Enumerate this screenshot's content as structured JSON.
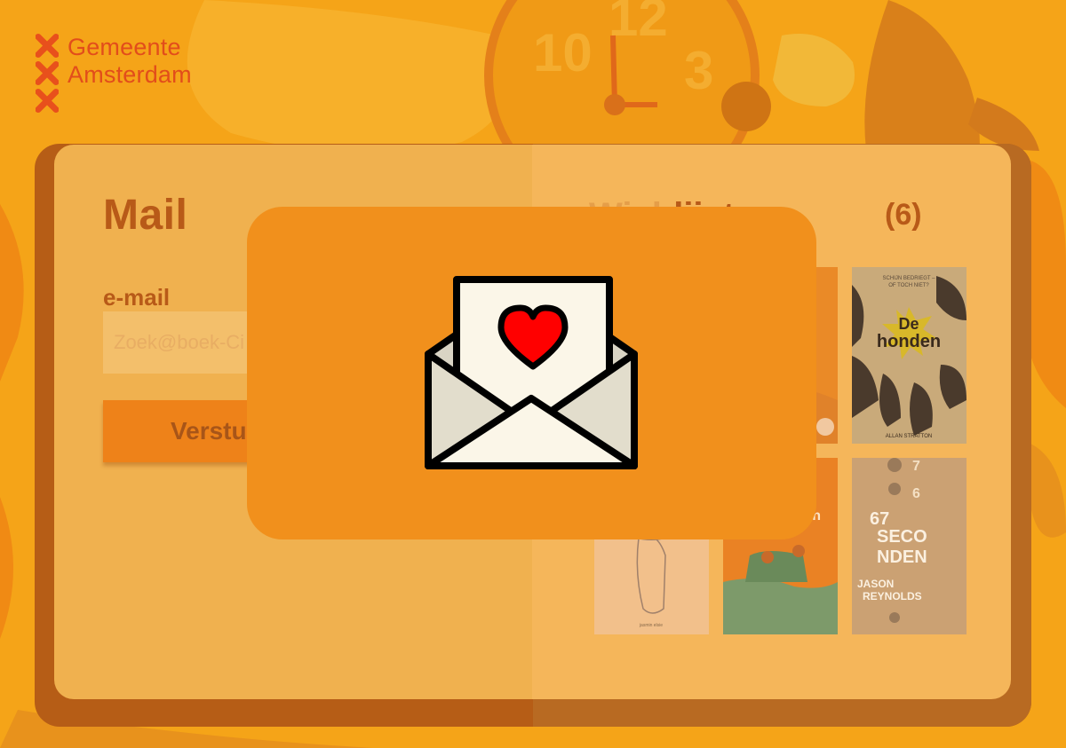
{
  "logo": {
    "lines": [
      "Gemeente",
      "Amsterdam"
    ]
  },
  "mail": {
    "title": "Mail",
    "email_label": "e-mail",
    "email_placeholder": "Zoek@boek-Ci",
    "send_label": "Verstu"
  },
  "wishlist": {
    "title": "lijst",
    "count": "(6)",
    "books": [
      {
        "title": ""
      },
      {
        "title": ""
      },
      {
        "title": "De honden",
        "author": "ALLAN STRATTON",
        "tagline": "SCHIJN BEDRIEGT – OF TOCH NIET?"
      },
      {
        "title": ""
      },
      {
        "title": "illen"
      },
      {
        "title": "67 SECONDEN",
        "author": "JASON REYNOLDS"
      }
    ]
  },
  "modal": {
    "icon": "envelope-heart-icon"
  },
  "colors": {
    "background": "#f5a418",
    "card_shadow": "#b65d16",
    "panel_left": "#f0b14f",
    "panel_right": "#f5b65a",
    "modal": "#f1901c",
    "heading": "#b85a18",
    "logo": "#e24d1b",
    "heart": "#ff0000"
  }
}
